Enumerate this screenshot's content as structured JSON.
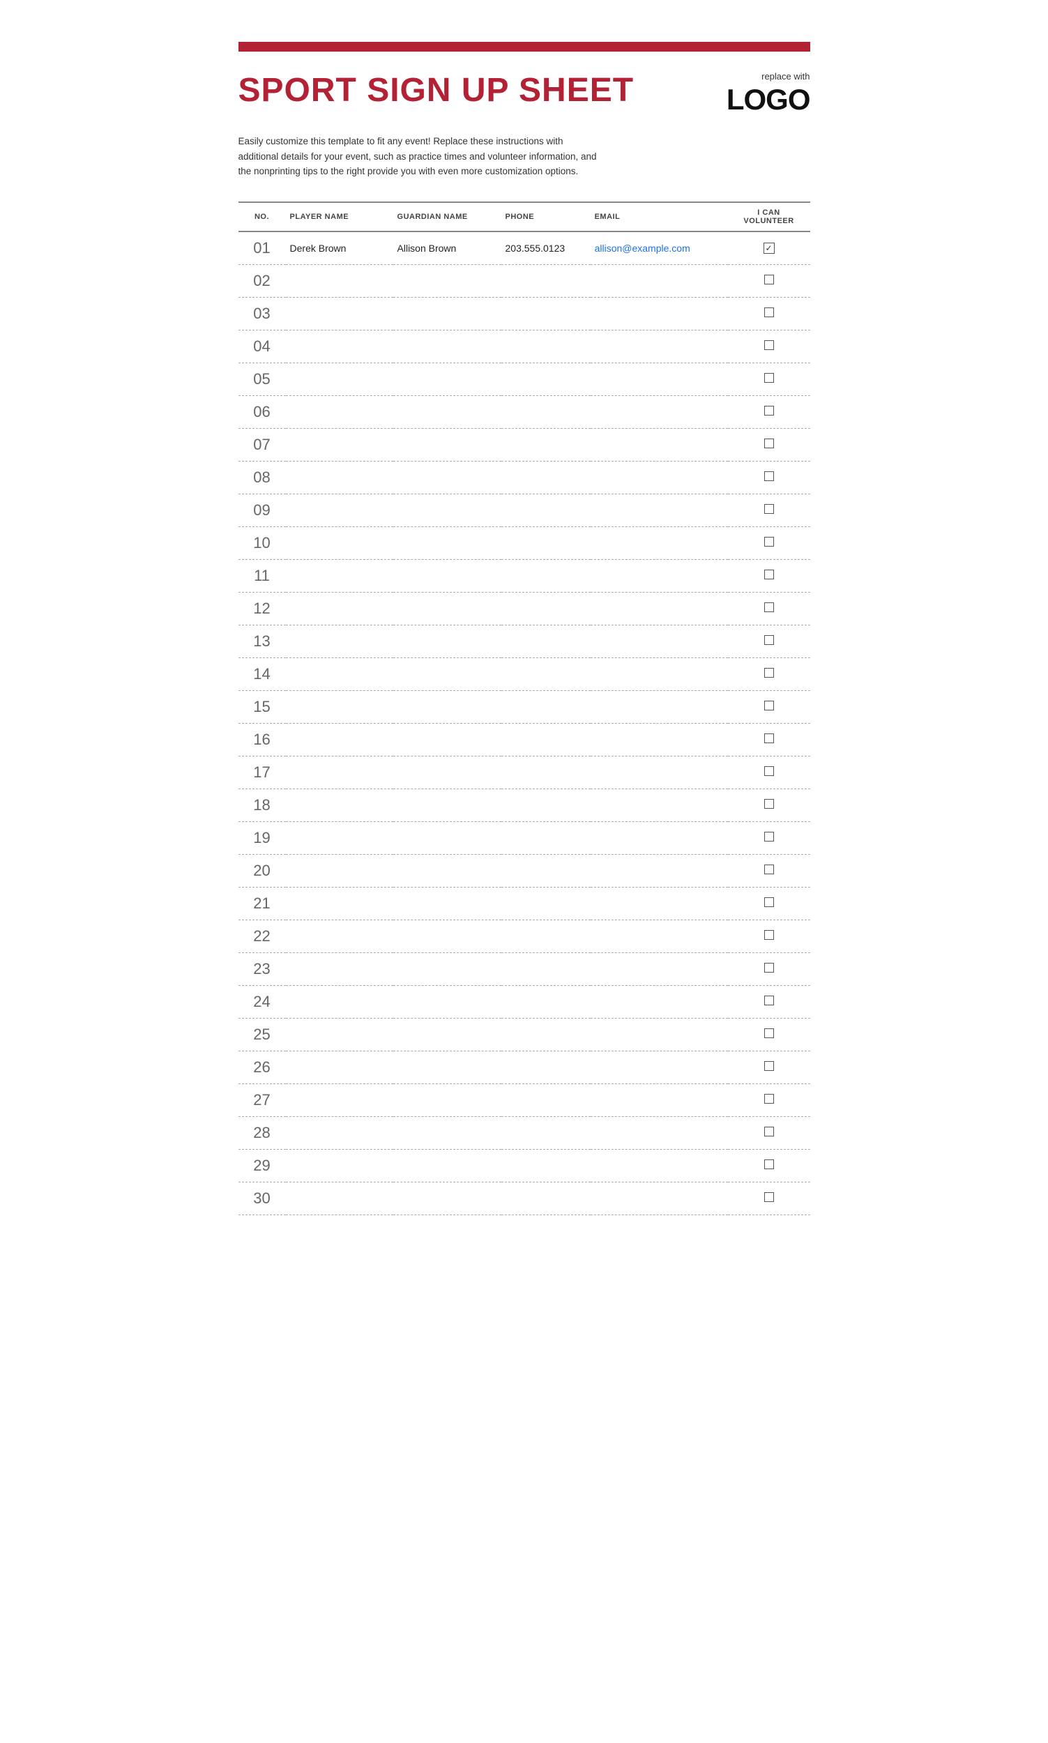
{
  "page": {
    "top_bar_color": "#b22234",
    "title": "SPORT SIGN UP SHEET",
    "logo": {
      "small_text": "replace with",
      "big_text": "LOGO"
    },
    "description": "Easily customize this template to fit any event! Replace these instructions with additional details for your event, such as practice times and volunteer information, and the nonprinting tips to the right provide you with even more customization options.",
    "table": {
      "headers": {
        "no": "NO.",
        "player_name": "PLAYER NAME",
        "guardian_name": "GUARDIAN NAME",
        "phone": "PHONE",
        "email": "EMAIL",
        "volunteer": "I CAN VOLUNTEER"
      },
      "first_row": {
        "no": "01",
        "player_name": "Derek Brown",
        "guardian_name": "Allison Brown",
        "phone": "203.555.0123",
        "email": "allison@example.com",
        "checked": true
      },
      "empty_rows": [
        "02",
        "03",
        "04",
        "05",
        "06",
        "07",
        "08",
        "09",
        "10",
        "11",
        "12",
        "13",
        "14",
        "15",
        "16",
        "17",
        "18",
        "19",
        "20",
        "21",
        "22",
        "23",
        "24",
        "25",
        "26",
        "27",
        "28",
        "29",
        "30"
      ]
    }
  }
}
